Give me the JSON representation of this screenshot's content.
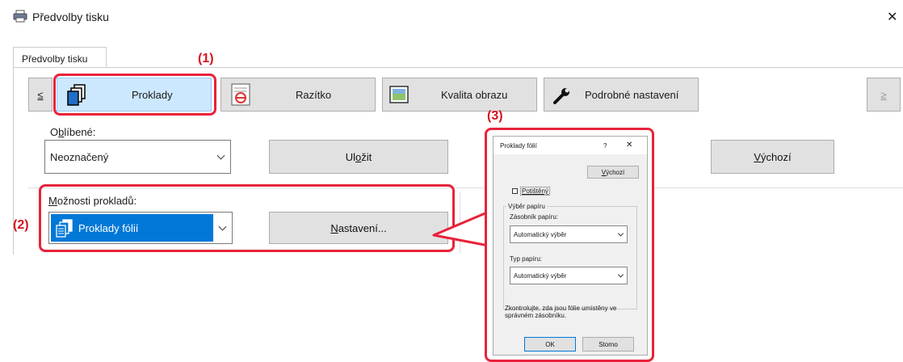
{
  "window": {
    "title": "Předvolby tisku",
    "close_glyph": "✕"
  },
  "tab": {
    "label": "Předvolby tisku"
  },
  "toolbar": {
    "prev": "≤",
    "next": "≥",
    "items": [
      {
        "label": "Proklady",
        "icon": "documents-icon"
      },
      {
        "label": "Razítko",
        "icon": "stamp-icon"
      },
      {
        "label": "Kvalita obrazu",
        "icon": "image-quality-icon"
      },
      {
        "label": "Podrobné nastavení",
        "icon": "wrench-icon"
      }
    ]
  },
  "favorites": {
    "label_pre": "O",
    "label_ul": "b",
    "label_post": "líbené:",
    "value": "Neoznačený",
    "save_pre": "Ul",
    "save_ul": "o",
    "save_post": "žit",
    "default_ul": "V",
    "default_post": "ýchozí"
  },
  "insert_options": {
    "label_pre": "",
    "label_ul": "M",
    "label_post": "ožnosti prokladů:",
    "value": "Proklady fólií",
    "settings_ul": "N",
    "settings_post": "astavení..."
  },
  "callouts": {
    "c1": "(1)",
    "c2": "(2)",
    "c3": "(3)"
  },
  "dialog": {
    "title": "Proklady fólií",
    "help": "?",
    "close": "✕",
    "default_ul": "V",
    "default_post": "ýchozí",
    "printed": "Potištěný",
    "group_label": "Výběr papíru",
    "tray_label": "Zásobník papíru:",
    "tray_value": "Automatický výběr",
    "type_label": "Typ papíru:",
    "type_value": "Automatický výběr",
    "note": "Zkontrolujte, zda jsou fólie umístěny ve správném zásobníku.",
    "ok": "OK",
    "cancel": "Storno"
  },
  "colors": {
    "accent": "#e8233a",
    "selected": "#cce8ff",
    "combo_selected": "#0078d7"
  }
}
